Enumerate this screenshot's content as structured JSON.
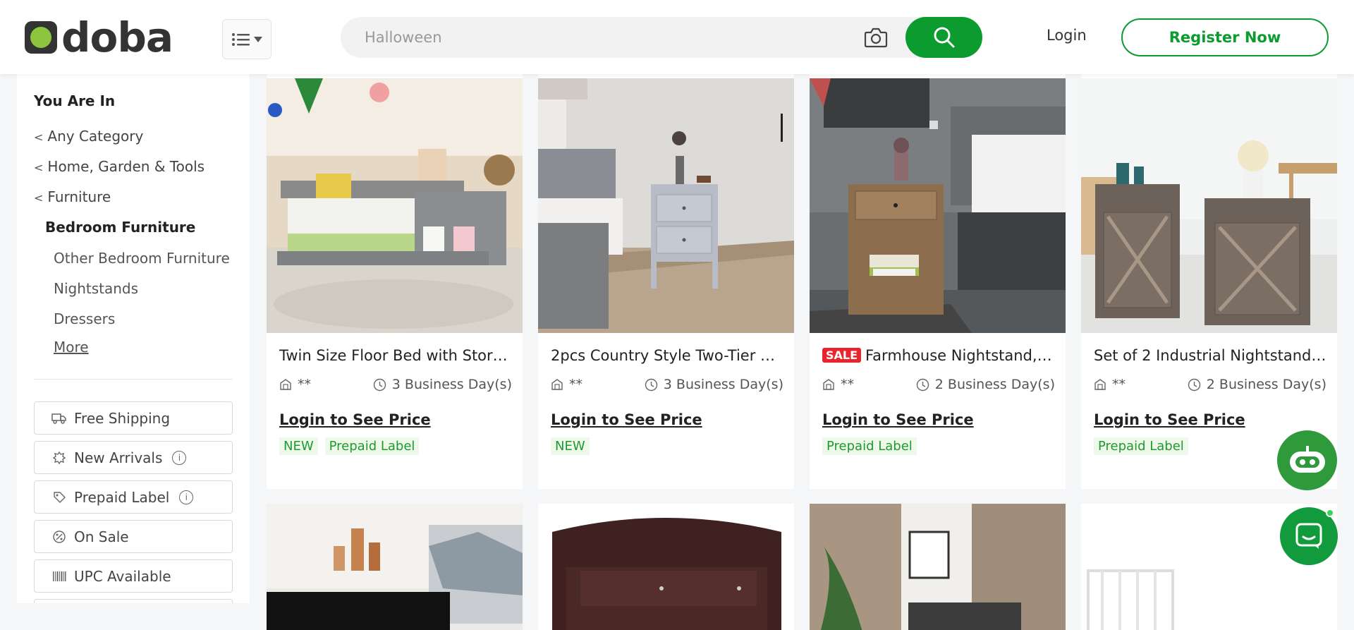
{
  "header": {
    "logo_text": "doba",
    "search_placeholder": "Halloween",
    "login_label": "Login",
    "register_label": "Register Now",
    "brand_color": "#0b9b2e"
  },
  "sidebar": {
    "heading": "You Are In",
    "breadcrumbs": [
      "Any Category",
      "Home, Garden & Tools",
      "Furniture"
    ],
    "current": "Bedroom Furniture",
    "subcategories": [
      "Other Bedroom Furniture",
      "Nightstands",
      "Dressers"
    ],
    "more_label": "More",
    "filters": [
      {
        "label": "Free Shipping",
        "icon": "truck-icon",
        "info": false
      },
      {
        "label": "New Arrivals",
        "icon": "new-icon",
        "info": true
      },
      {
        "label": "Prepaid Label",
        "icon": "label-icon",
        "info": true
      },
      {
        "label": "On Sale",
        "icon": "sale-icon",
        "info": false
      },
      {
        "label": "UPC Available",
        "icon": "barcode-icon",
        "info": false
      }
    ]
  },
  "products": [
    {
      "title": "Twin Size Floor Bed with Stora...",
      "sale": false,
      "warehouse": "**",
      "ship": "3 Business Day(s)",
      "price_label": "Login to See Price",
      "tags": [
        "NEW",
        "Prepaid Label"
      ]
    },
    {
      "title": "2pcs Country Style Two-Tier N...",
      "sale": false,
      "warehouse": "**",
      "ship": "3 Business Day(s)",
      "price_label": "Login to See Price",
      "tags": [
        "NEW"
      ]
    },
    {
      "title": "Farmhouse Nightstand, ...",
      "sale": true,
      "sale_label": "SALE",
      "warehouse": "**",
      "ship": "2 Business Day(s)",
      "price_label": "Login to See Price",
      "tags": [
        "Prepaid Label"
      ]
    },
    {
      "title": "Set of 2 Industrial Nightstand ...",
      "sale": false,
      "warehouse": "**",
      "ship": "2 Business Day(s)",
      "price_label": "Login to See Price",
      "tags": [
        "Prepaid Label"
      ]
    }
  ]
}
